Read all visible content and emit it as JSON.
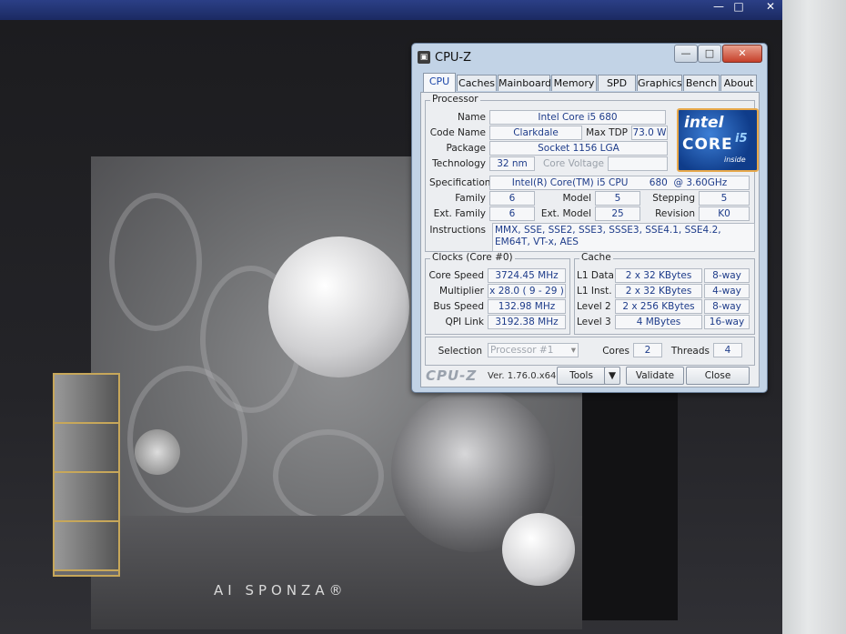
{
  "window": {
    "title": "CPU-Z",
    "controls": {
      "minimize": "—",
      "maximize": "□",
      "close": "✕"
    }
  },
  "tabs": [
    "CPU",
    "Caches",
    "Mainboard",
    "Memory",
    "SPD",
    "Graphics",
    "Bench",
    "About"
  ],
  "active_tab": "CPU",
  "processor": {
    "group_label": "Processor",
    "name_label": "Name",
    "name": "Intel Core i5 680",
    "codename_label": "Code Name",
    "codename": "Clarkdale",
    "maxtdp_label": "Max TDP",
    "maxtdp": "73.0 W",
    "package_label": "Package",
    "package": "Socket 1156 LGA",
    "technology_label": "Technology",
    "technology": "32 nm",
    "corevoltage_label": "Core Voltage",
    "corevoltage": "",
    "spec_label": "Specification",
    "spec": "Intel(R) Core(TM) i5 CPU       680  @ 3.60GHz",
    "family_label": "Family",
    "family": "6",
    "model_label": "Model",
    "model": "5",
    "stepping_label": "Stepping",
    "stepping": "5",
    "extfamily_label": "Ext. Family",
    "extfamily": "6",
    "extmodel_label": "Ext. Model",
    "extmodel": "25",
    "revision_label": "Revision",
    "revision": "K0",
    "instructions_label": "Instructions",
    "instructions": "MMX, SSE, SSE2, SSE3, SSSE3, SSE4.1, SSE4.2, EM64T, VT-x, AES"
  },
  "intel_logo": {
    "brand": "intel",
    "core": "CORE",
    "model": "i5",
    "inside": "inside"
  },
  "clocks": {
    "group_label": "Clocks (Core #0)",
    "corespeed_label": "Core Speed",
    "corespeed": "3724.45 MHz",
    "multiplier_label": "Multiplier",
    "multiplier": "x 28.0 ( 9 - 29 )",
    "busspeed_label": "Bus Speed",
    "busspeed": "132.98 MHz",
    "qpilink_label": "QPI Link",
    "qpilink": "3192.38 MHz"
  },
  "cache": {
    "group_label": "Cache",
    "l1data_label": "L1 Data",
    "l1data": "2 x 32 KBytes",
    "l1data_way": "8-way",
    "l1inst_label": "L1 Inst.",
    "l1inst": "2 x 32 KBytes",
    "l1inst_way": "4-way",
    "level2_label": "Level 2",
    "level2": "2 x 256 KBytes",
    "level2_way": "8-way",
    "level3_label": "Level 3",
    "level3": "4 MBytes",
    "level3_way": "16-way"
  },
  "selection": {
    "label": "Selection",
    "value": "Processor #1",
    "cores_label": "Cores",
    "cores": "2",
    "threads_label": "Threads",
    "threads": "4"
  },
  "footer": {
    "brand": "CPU-Z",
    "version": "Ver. 1.76.0.x64",
    "tools": "Tools",
    "validate": "Validate",
    "close": "Close"
  },
  "background": {
    "logo_text": "AI SPONZA®"
  }
}
